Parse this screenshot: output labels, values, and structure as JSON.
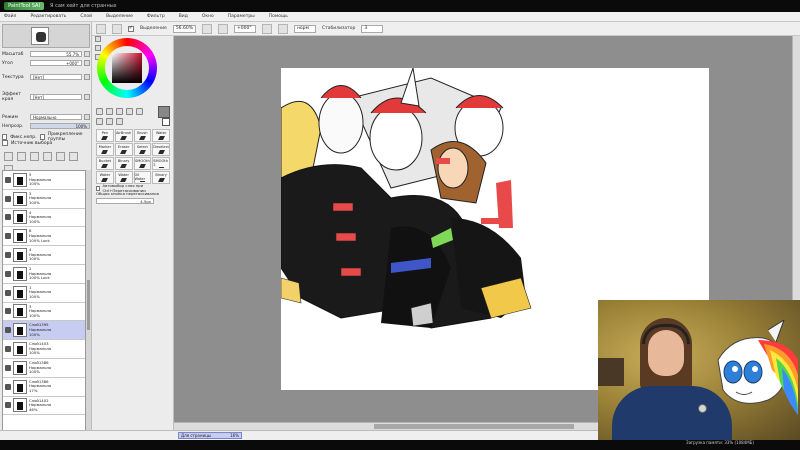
{
  "app": {
    "logo_text": "PaintTool SAI",
    "window_caption": "Я сам хейт для странных"
  },
  "menu": [
    "Файл",
    "Редактировать",
    "Слой",
    "Выделение",
    "Фильтр",
    "Вид",
    "Окно",
    "Параметры",
    "Помощь"
  ],
  "toolbar": {
    "selection_label": "Выделение",
    "zoom_value": "56.60%",
    "rotation_value": "+000°",
    "mode_value": "норм",
    "stabilizer_label": "Стабилизатор",
    "stabilizer_value": "3"
  },
  "navigator": {
    "zoom_label": "Масштаб",
    "zoom_value": "55.7%",
    "angle_label": "Угол",
    "angle_value": "+000°"
  },
  "layer_props": {
    "texture_label": "Текстура",
    "texture_value": "[Нет]",
    "effect_label": "Эффект края",
    "effect_value": "[Нет]",
    "mode_label": "Режим",
    "mode_value": "Нормально",
    "opacity_label": "Непрозр.",
    "opacity_value": "100%",
    "preserve_opacity_label": "Фикс.непр.",
    "clipping_label": "Прикрепление группы",
    "selection_source_label": "Источник выбора"
  },
  "layers": [
    {
      "name": "5",
      "mode": "Нормально",
      "opacity": "100%",
      "selected": false
    },
    {
      "name": "3",
      "mode": "Нормально",
      "opacity": "100%",
      "selected": false
    },
    {
      "name": "4",
      "mode": "Нормально",
      "opacity": "100%",
      "selected": false
    },
    {
      "name": "8",
      "mode": "Нормально",
      "opacity": "100% Lock",
      "selected": false
    },
    {
      "name": "4",
      "mode": "Нормально",
      "opacity": "100%",
      "selected": false
    },
    {
      "name": "2",
      "mode": "Нормально",
      "opacity": "100% Lock",
      "selected": false
    },
    {
      "name": "1",
      "mode": "Нормально",
      "opacity": "100%",
      "selected": false
    },
    {
      "name": "3",
      "mode": "Нормально",
      "opacity": "100%",
      "selected": false
    },
    {
      "name": "Слой1395",
      "mode": "Нормально",
      "opacity": "100%",
      "selected": true
    },
    {
      "name": "Слой1403",
      "mode": "Нормально",
      "opacity": "100%",
      "selected": false
    },
    {
      "name": "Слой1386",
      "mode": "Нормально",
      "opacity": "100%",
      "selected": false
    },
    {
      "name": "Слой1386",
      "mode": "Нормально",
      "opacity": "17%",
      "selected": false
    },
    {
      "name": "Слой1402",
      "mode": "Нормально",
      "opacity": "46%",
      "selected": false
    }
  ],
  "brushes": [
    "Pen",
    "AirBrush",
    "Brush",
    "Water",
    "Marker",
    "Eraser",
    "Select",
    "Deselect",
    "Bucket",
    "Binary",
    "SMOOth",
    "SMOOth 2",
    "Water",
    "Water",
    "Oil Water",
    "Binary"
  ],
  "tool_options": {
    "autoselect_label": "Автовыбор слоя при Ctrl+Перетаскивании",
    "overall_label": "Общая кнопка перетаскивания",
    "overall_value": "4.5px"
  },
  "status": {
    "layer_name": "Для страницы",
    "layer_pct": "16%",
    "memory_text": "Загрузка памяти: 33% (1084МБ)"
  },
  "colors": {
    "accent_selected": "#c7cdf2",
    "canvas_bg": "#8e8e8e"
  }
}
